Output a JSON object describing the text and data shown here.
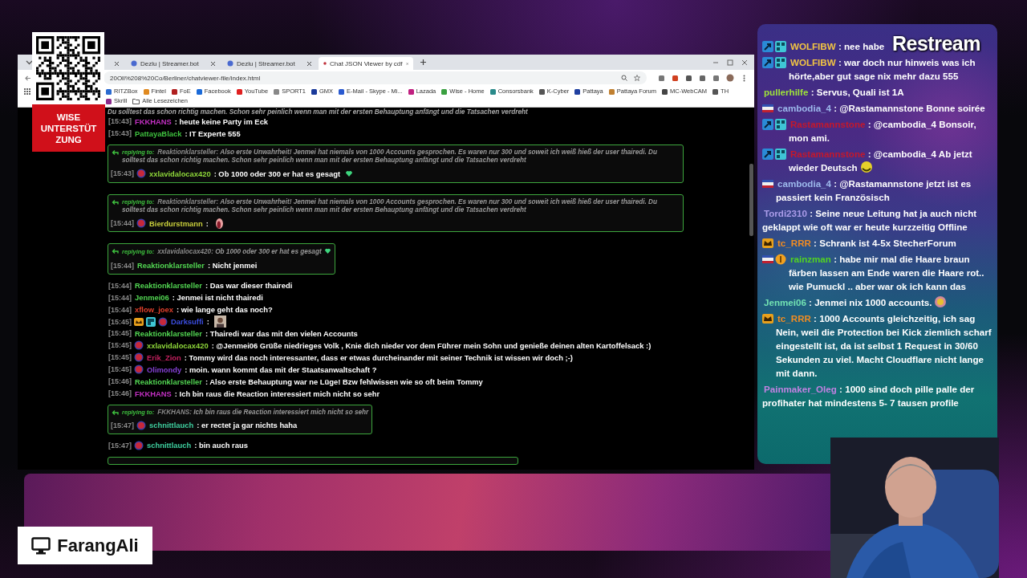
{
  "overlay": {
    "qr_caption": [
      "WISE",
      "UNTERSTÜT",
      "ZUNG"
    ],
    "channel_name": "FarangAli",
    "logo": "Restream"
  },
  "browser": {
    "tabs": [
      {
        "selected": false
      },
      {
        "label": "Dezlu | Streamer.bot",
        "selected": false
      },
      {
        "label": "Dezlu | Streamer.bot",
        "selected": false
      },
      {
        "label": "Chat JSON Viewer by cdf",
        "selected": true
      }
    ],
    "address": "20Oll%208%20Co/Berliner/chatviewer-file/index.html",
    "bookmarks": [
      "RITZBox",
      "Fintel",
      "FoE",
      "Facebook",
      "YouTube",
      "SPORT1",
      "GMX",
      "E-Mail - Skype - Mi...",
      "Lazada",
      "Wise - Home",
      "Consorsbank",
      "K-Cyber",
      "Pattaya",
      "Pattaya Forum",
      "MC-WebCAM",
      "TH",
      "Skrill"
    ],
    "bookmarks_folder": "Alle Lesezeichen"
  },
  "chat": {
    "cut_line": "Du solltest das schon richtig machen. Schon sehr peinlich wenn man mit der ersten Behauptung anfängt und die Tatsachen verdreht",
    "messages": [
      {
        "kind": "plain",
        "time": "[15:43]",
        "user": "FKKHANS",
        "color": "#c22fc2",
        "text": ": heute keine Party im Eck"
      },
      {
        "kind": "plain",
        "time": "[15:43]",
        "user": "PattayaBlack",
        "color": "#3fc23f",
        "text": ": IT Experte 555"
      },
      {
        "kind": "reply",
        "reply_label": "replying to:",
        "reply_user": "Reaktionklarsteller:",
        "reply_text": "Also erste Unwahrheit! Jenmei hat niemals von 1000 Accounts gesprochen. Es waren nur 300 und soweit ich weiß hieß der user thairedi. Du solltest das schon richtig machen. Schon sehr peinlich wenn man mit der ersten Behauptung anfängt und die Tatsachen verdreht",
        "time": "[15:43]",
        "badges": [
          {
            "kind": "sub"
          }
        ],
        "user": "xxlavidalocax420",
        "color": "#8fd83a",
        "text": ": Ob 1000 oder 300 er hat es gesagt",
        "emote": {
          "kind": "heart"
        }
      },
      {
        "kind": "reply",
        "reply_label": "replying to:",
        "reply_user": "Reaktionklarsteller:",
        "reply_text": "Also erste Unwahrheit! Jenmei hat niemals von 1000 Accounts gesprochen. Es waren nur 300 und soweit ich weiß hieß der user thairedi. Du solltest das schon richtig machen. Schon sehr peinlich wenn man mit der ersten Behauptung anfängt und die Tatsachen verdreht",
        "time": "[15:44]",
        "badges": [
          {
            "kind": "sub"
          }
        ],
        "user": "Bierdurstmann",
        "color": "#c9cf3c",
        "text": ":",
        "emote": {
          "kind": "blob"
        }
      },
      {
        "kind": "reply",
        "reply_label": "replying to:",
        "reply_user": "xxlavidalocax420:",
        "reply_text": "Ob 1000 oder 300 er hat es gesagt",
        "reply_emote": {
          "kind": "heart"
        },
        "time": "[15:44]",
        "user": "Reaktionklarsteller",
        "color": "#52d652",
        "text": ": Nicht jenmei"
      },
      {
        "kind": "plain",
        "time": "[15:44]",
        "user": "Reaktionklarsteller",
        "color": "#52d652",
        "text": ": Das war dieser thairedi"
      },
      {
        "kind": "plain",
        "time": "[15:44]",
        "user": "Jenmei06",
        "color": "#52d652",
        "text": ": Jenmei ist nicht thairedi"
      },
      {
        "kind": "plain",
        "time": "[15:44]",
        "user": "xflow_joex",
        "color": "#e0402c",
        "text": ": wie lange geht das noch?"
      },
      {
        "kind": "plain",
        "time": "[15:45]",
        "badges": [
          {
            "kind": "crown"
          },
          {
            "kind": "gg"
          },
          {
            "kind": "sub"
          }
        ],
        "user": "Darksuffi",
        "color": "#3b4de0",
        "text": ":",
        "emote": {
          "kind": "avatar"
        }
      },
      {
        "kind": "plain",
        "time": "[15:45]",
        "user": "Reaktionklarsteller",
        "color": "#52d652",
        "text": ": Thairedi war das mit den vielen Accounts"
      },
      {
        "kind": "plain",
        "time": "[15:45]",
        "badges": [
          {
            "kind": "sub"
          }
        ],
        "user": "xxlavidalocax420",
        "color": "#8fd83a",
        "text": ": @Jenmei06 Grüße niedrieges Volk , Knie dich nieder vor dem Führer mein Sohn und genieße deinen alten Kartoffelsack :)"
      },
      {
        "kind": "plain",
        "time": "[15:45]",
        "badges": [
          {
            "kind": "sub"
          }
        ],
        "user": "Erik_Zion",
        "color": "#c2205e",
        "text": ": Tommy wird das noch interessanter, dass er etwas durcheinander mit seiner Technik ist wissen wir doch ;-)"
      },
      {
        "kind": "plain",
        "time": "[15:45]",
        "badges": [
          {
            "kind": "sub"
          }
        ],
        "user": "Olimondy",
        "color": "#8440d4",
        "text": ": moin. wann kommt das mit der Staatsanwaltschaft ?"
      },
      {
        "kind": "plain",
        "time": "[15:46]",
        "user": "Reaktionklarsteller",
        "color": "#52d652",
        "text": ": Also erste Behauptung war ne Lüge! Bzw fehlwissen wie so oft beim Tommy"
      },
      {
        "kind": "plain",
        "time": "[15:46]",
        "user": "FKKHANS",
        "color": "#c22fc2",
        "text": ": Ich bin raus die Reaction interessiert mich nicht so sehr"
      },
      {
        "kind": "reply",
        "reply_label": "replying to:",
        "reply_user": "FKKHANS:",
        "reply_text": "Ich bin raus die Reaction interessiert mich nicht so sehr",
        "time": "[15:47]",
        "badges": [
          {
            "kind": "sub"
          }
        ],
        "user": "schnittlauch",
        "color": "#3fd0a0",
        "text": ": er rectet ja gar nichts haha"
      },
      {
        "kind": "plain",
        "time": "[15:47]",
        "badges": [
          {
            "kind": "sub"
          }
        ],
        "user": "schnittlauch",
        "color": "#3fd0a0",
        "text": ": bin auch raus"
      }
    ]
  },
  "side_chat": {
    "messages": [
      {
        "badges": [
          {
            "kind": "kick"
          },
          {
            "kind": "gg"
          }
        ],
        "user": "WOLFIBW",
        "color": "#f2c443",
        "text": ": nee habe"
      },
      {
        "badges": [
          {
            "kind": "kick"
          },
          {
            "kind": "gg"
          }
        ],
        "user": "WOLFIBW",
        "color": "#f2c443",
        "text": ": war doch nur hinweis was ich hörte,aber gut sage nix mehr dazu 555"
      },
      {
        "user": "pullerhilfe",
        "color": "#9ee23a",
        "text": ": Servus, Quali ist 1A"
      },
      {
        "badges": [
          {
            "kind": "flag"
          }
        ],
        "user": "cambodia_4",
        "color": "#9db9ec",
        "text": ": @Rastamannstone Bonne soirée"
      },
      {
        "badges": [
          {
            "kind": "kick"
          },
          {
            "kind": "gg"
          }
        ],
        "user": "Rastamannstone",
        "color": "#c4182c",
        "text": ": @cambodia_4 Bonsoir, mon ami."
      },
      {
        "badges": [
          {
            "kind": "kick"
          },
          {
            "kind": "gg"
          }
        ],
        "user": "Rastamannstone",
        "color": "#c4182c",
        "text": ": @cambodia_4 Ab jetzt wieder Deutsch",
        "emote": {
          "kind": "smiley"
        }
      },
      {
        "badges": [
          {
            "kind": "flag"
          }
        ],
        "user": "cambodia_4",
        "color": "#9db9ec",
        "text": ": @Rastamannstone jetzt ist es passiert kein Französisch"
      },
      {
        "user": "Tordi2310",
        "color": "#aa9ce9",
        "text": ": Seine neue Leitung hat ja auch nicht geklappt wie oft war er heute kurzzeitig Offline"
      },
      {
        "badges": [
          {
            "kind": "crown"
          }
        ],
        "user": "tc_RRR",
        "color": "#f08c22",
        "text": ": Schrank ist 4-5x StecherForum"
      },
      {
        "badges": [
          {
            "kind": "flag"
          },
          {
            "kind": "coin"
          }
        ],
        "user": "rainzman",
        "color": "#52d222",
        "text": ": habe mir mal die Haare braun färben lassen am Ende waren die Haare rot.. wie Pumuckl .. aber war ok ich kann das"
      },
      {
        "user": "Jenmei06",
        "color": "#72e2b2",
        "text": ": Jenmei nix 1000 accounts.",
        "emote": {
          "kind": "medal"
        }
      },
      {
        "badges": [
          {
            "kind": "crown"
          }
        ],
        "user": "tc_RRR",
        "color": "#f08c22",
        "text": ": 1000 Accounts gleichzeitig, ich sag Nein, weil die Protection bei Kick ziemlich scharf eingestellt ist, da ist selbst 1 Request in 30/60 Sekunden zu viel. Macht Cloudflare nicht lange mit dann."
      },
      {
        "user": "Painmaker_Oleg",
        "color": "#c282e2",
        "text": ": 1000 sind doch pille palle der profihater hat mindestens 5- 7 tausen profile"
      }
    ]
  }
}
